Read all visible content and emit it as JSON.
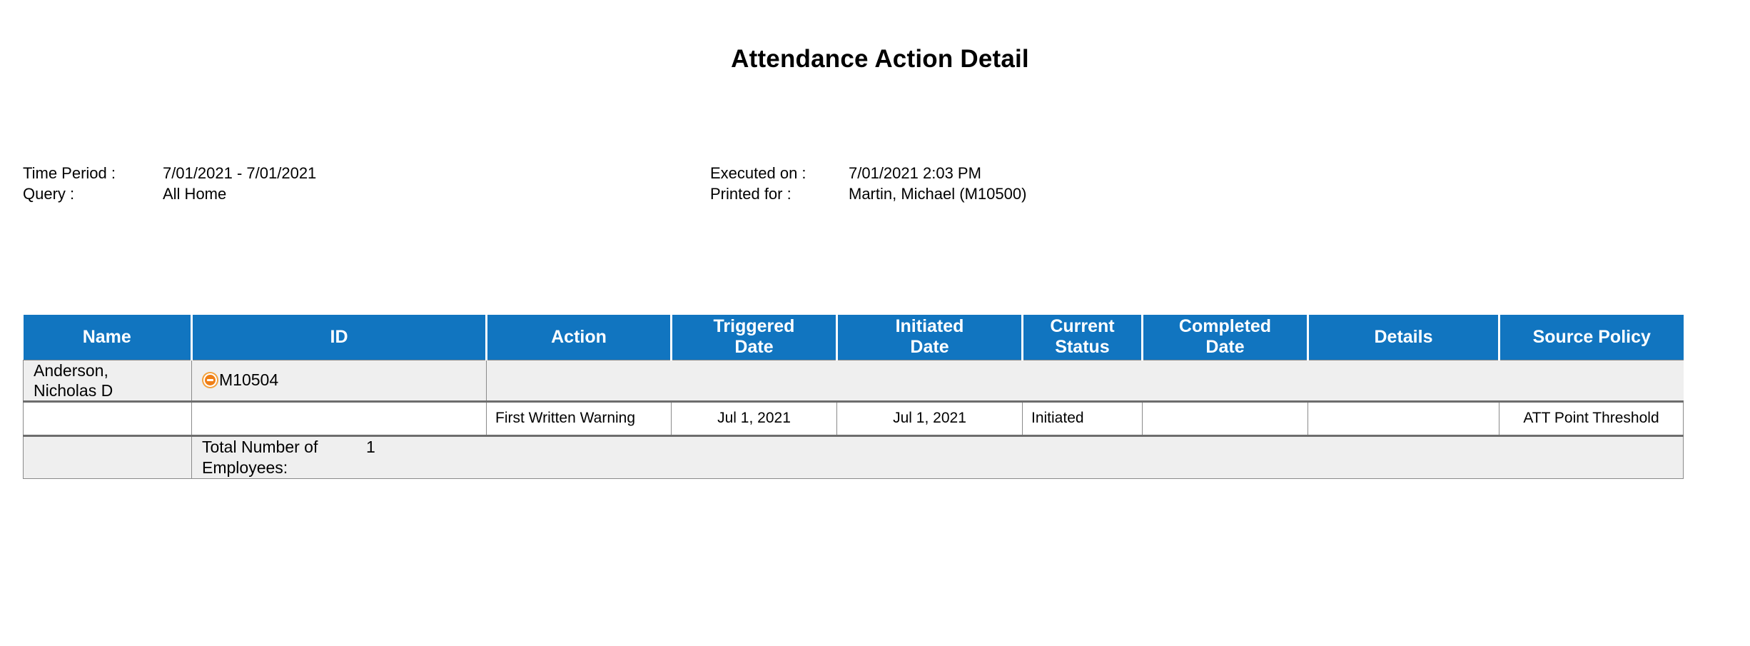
{
  "report": {
    "title": "Attendance Action Detail"
  },
  "meta": {
    "left": [
      {
        "label": "Time Period :",
        "value": "7/01/2021 - 7/01/2021"
      },
      {
        "label": "Query :",
        "value": "All Home"
      }
    ],
    "right": [
      {
        "label": "Executed on :",
        "value": "7/01/2021 2:03 PM"
      },
      {
        "label": "Printed for :",
        "value": "Martin, Michael (M10500)"
      }
    ]
  },
  "table": {
    "columns": [
      "Name",
      "ID",
      "Action",
      "Triggered Date",
      "Initiated Date",
      "Current Status",
      "Completed Date",
      "Details",
      "Source Policy"
    ],
    "columns_multiline": [
      [
        "Name"
      ],
      [
        "ID"
      ],
      [
        "Action"
      ],
      [
        "Triggered",
        "Date"
      ],
      [
        "Initiated",
        "Date"
      ],
      [
        "Current",
        "Status"
      ],
      [
        "Completed",
        "Date"
      ],
      [
        "Details"
      ],
      [
        "Source Policy"
      ]
    ],
    "employee": {
      "name": "Anderson, Nicholas D",
      "name_lines": [
        "Anderson,",
        "Nicholas D"
      ],
      "id": "M10504",
      "collapse_icon": "minus-circle-icon"
    },
    "detail_rows": [
      {
        "name": "",
        "id": "",
        "action": "First Written Warning",
        "triggered_date": "Jul 1, 2021",
        "initiated_date": "Jul 1, 2021",
        "current_status": "Initiated",
        "completed_date": "",
        "details": "",
        "source_policy": "ATT Point Threshold"
      }
    ],
    "total": {
      "label": "Total Number of Employees:",
      "label_lines": [
        "Total Number of",
        "Employees:"
      ],
      "count": "1"
    }
  },
  "colors": {
    "header_blue": "#1175c0",
    "row_gray": "#efefef",
    "border_gray": "#8a8a8a",
    "thick_border_gray": "#6d6d6d",
    "icon_orange": "#ef7f17"
  }
}
